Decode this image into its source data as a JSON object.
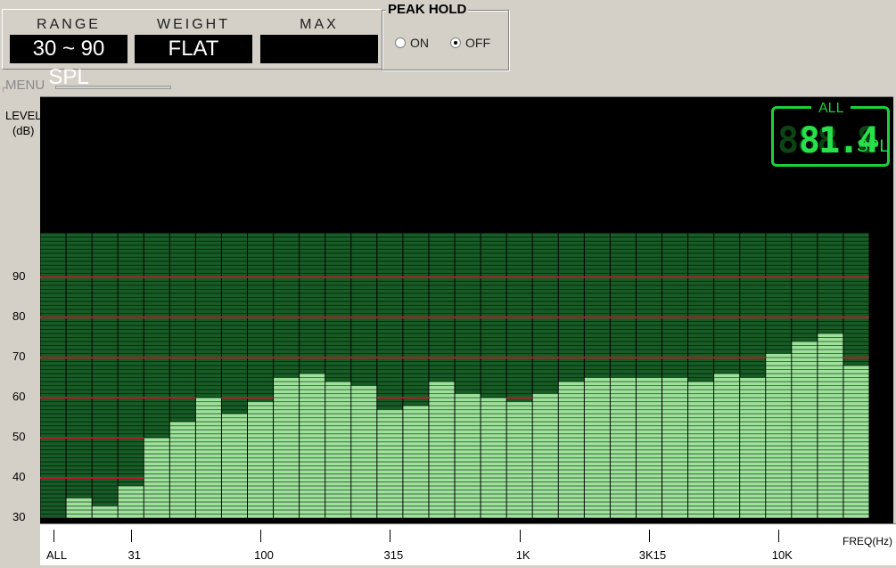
{
  "top_panel": {
    "range": {
      "label": "RANGE",
      "value": "30 ~ 90 SPL"
    },
    "weight": {
      "label": "WEIGHT",
      "value": "FLAT"
    },
    "max": {
      "label": "MAX",
      "value": ""
    }
  },
  "peak_hold": {
    "title": "PEAK HOLD",
    "options": [
      {
        "label": "ON",
        "selected": false
      },
      {
        "label": "OFF",
        "selected": true
      }
    ]
  },
  "menu": {
    "title": "MENU"
  },
  "readout": {
    "title": "ALL",
    "ghost": "888.8",
    "value": "81.4",
    "unit": "SPL"
  },
  "colors": {
    "bar": "#9de29b",
    "bar_dark": "#175c26",
    "reference_line": "#c0142a",
    "readout": "#27e04a"
  },
  "chart_data": {
    "type": "bar",
    "ylabel": "LEVEL\n(dB)",
    "ylabel_lines": [
      "LEVEL",
      "(dB)"
    ],
    "xlabel": "FREQ(Hz)",
    "ylim": [
      30,
      90
    ],
    "yticks": [
      30,
      40,
      50,
      60,
      70,
      80,
      90
    ],
    "reference_lines": [
      40,
      50,
      60,
      70,
      80,
      90
    ],
    "x_tick_labels": [
      "ALL",
      "31",
      "100",
      "315",
      "1K",
      "3K15",
      "10K"
    ],
    "x_tick_bands": [
      0,
      3,
      8,
      13,
      18,
      23,
      28
    ],
    "bands": 32,
    "values": [
      30,
      35,
      33,
      38,
      50,
      54,
      60,
      56,
      59,
      65,
      66,
      64,
      63,
      57,
      58,
      64,
      61,
      60,
      59,
      61,
      64,
      65,
      65,
      65,
      65,
      64,
      66,
      65,
      71,
      74,
      76,
      68
    ]
  }
}
